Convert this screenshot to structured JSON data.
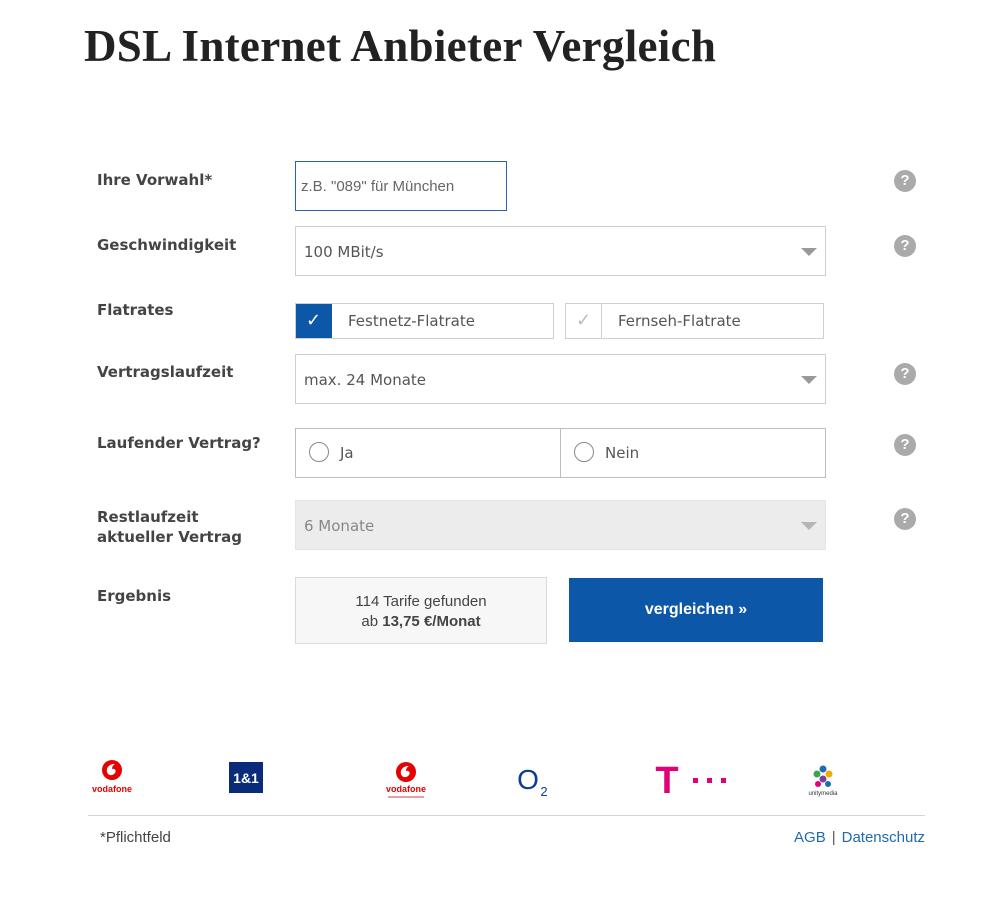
{
  "title": "DSL Internet Anbieter Vergleich",
  "form": {
    "vorwahl": {
      "label": "Ihre Vorwahl*",
      "placeholder": "z.B. \"089\" für München",
      "value": ""
    },
    "speed": {
      "label": "Geschwindigkeit",
      "value": "100 MBit/s"
    },
    "flatrates": {
      "label": "Flatrates",
      "festnetz": {
        "label": "Festnetz-Flatrate",
        "checked": true
      },
      "fernseh": {
        "label": "Fernseh-Flatrate",
        "checked": false
      }
    },
    "laufzeit": {
      "label": "Vertragslaufzeit",
      "value": "max. 24 Monate"
    },
    "laufend": {
      "label": "Laufender Vertrag?",
      "ja": "Ja",
      "nein": "Nein"
    },
    "restlaufzeit": {
      "label_line1": "Restlaufzeit",
      "label_line2": "aktueller Vertrag",
      "value": "6 Monate"
    },
    "ergebnis": {
      "label": "Ergebnis",
      "line1": "114 Tarife gefunden",
      "line2_prefix": "ab",
      "line2_price": "13,75 €/Monat"
    },
    "submit": "vergleichen »",
    "help_glyph": "?",
    "check_glyph": "✓"
  },
  "logos": {
    "vodafone_1": "vodafone",
    "one_and_one": "1&1",
    "vodafone_2": "vodafone",
    "o2": "O",
    "o2_sub": "2",
    "telekom": "T",
    "unitymedia": "unitymedia"
  },
  "footer": {
    "note": "*Pflichtfeld",
    "agb": "AGB",
    "separator": "|",
    "datenschutz": "Datenschutz"
  },
  "colors": {
    "primary": "#0d57a8",
    "telekom_magenta": "#e20074",
    "vodafone_red": "#e60000",
    "o2_blue": "#0a3d91"
  }
}
